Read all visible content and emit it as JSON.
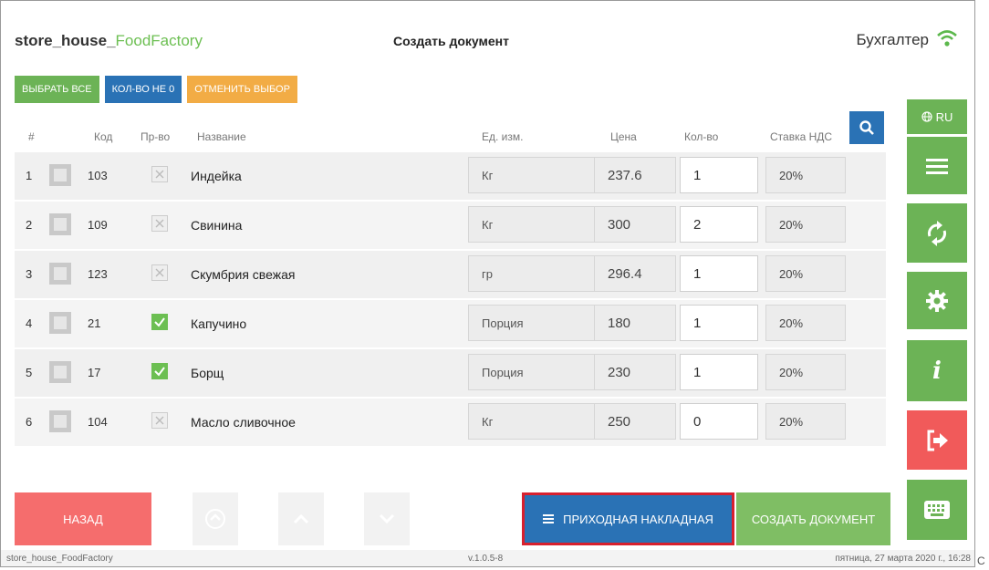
{
  "header": {
    "brand_prefix": "store_house_",
    "brand_suffix": "FoodFactory",
    "title": "Создать документ",
    "role": "Бухгалтер"
  },
  "toolbar": {
    "select_all": "ВЫБРАТЬ ВСЕ",
    "qty_not_zero": "КОЛ-ВО НЕ 0",
    "cancel_selection": "ОТМЕНИТЬ ВЫБОР"
  },
  "columns": {
    "num": "#",
    "code": "Код",
    "production": "Пр-во",
    "name": "Название",
    "unit": "Ед. изм.",
    "price": "Цена",
    "qty": "Кол-во",
    "vat": "Ставка НДС"
  },
  "rows": [
    {
      "num": "1",
      "code": "103",
      "production": false,
      "name": "Индейка",
      "unit": "Кг",
      "price": "237.6",
      "qty": "1",
      "vat": "20%"
    },
    {
      "num": "2",
      "code": "109",
      "production": false,
      "name": "Свинина",
      "unit": "Кг",
      "price": "300",
      "qty": "2",
      "vat": "20%"
    },
    {
      "num": "3",
      "code": "123",
      "production": false,
      "name": "Скумбрия свежая",
      "unit": "гр",
      "price": "296.4",
      "qty": "1",
      "vat": "20%"
    },
    {
      "num": "4",
      "code": "21",
      "production": true,
      "name": "Капучино",
      "unit": "Порция",
      "price": "180",
      "qty": "1",
      "vat": "20%"
    },
    {
      "num": "5",
      "code": "17",
      "production": true,
      "name": "Борщ",
      "unit": "Порция",
      "price": "230",
      "qty": "1",
      "vat": "20%"
    },
    {
      "num": "6",
      "code": "104",
      "production": false,
      "name": "Масло сливочное",
      "unit": "Кг",
      "price": "250",
      "qty": "0",
      "vat": "20%"
    }
  ],
  "sidebar": {
    "language": "RU",
    "icons": [
      "menu-icon",
      "sync-icon",
      "gear-icon",
      "info-icon",
      "logout-icon",
      "keyboard-icon"
    ]
  },
  "bottom": {
    "back": "НАЗАД",
    "invoice": "ПРИХОДНАЯ НАКЛАДНАЯ",
    "create": "СОЗДАТЬ ДОКУМЕНТ"
  },
  "footer": {
    "app": "store_house_FoodFactory",
    "version": "v.1.0.5-8",
    "datetime": "пятница, 27 марта 2020 г., 16:28"
  },
  "outside_letter": "С",
  "colors": {
    "green": "#6cb356",
    "blue": "#2a72b5",
    "orange": "#f2ac45",
    "red": "#f15a5a",
    "highlight": "#d8202e"
  }
}
